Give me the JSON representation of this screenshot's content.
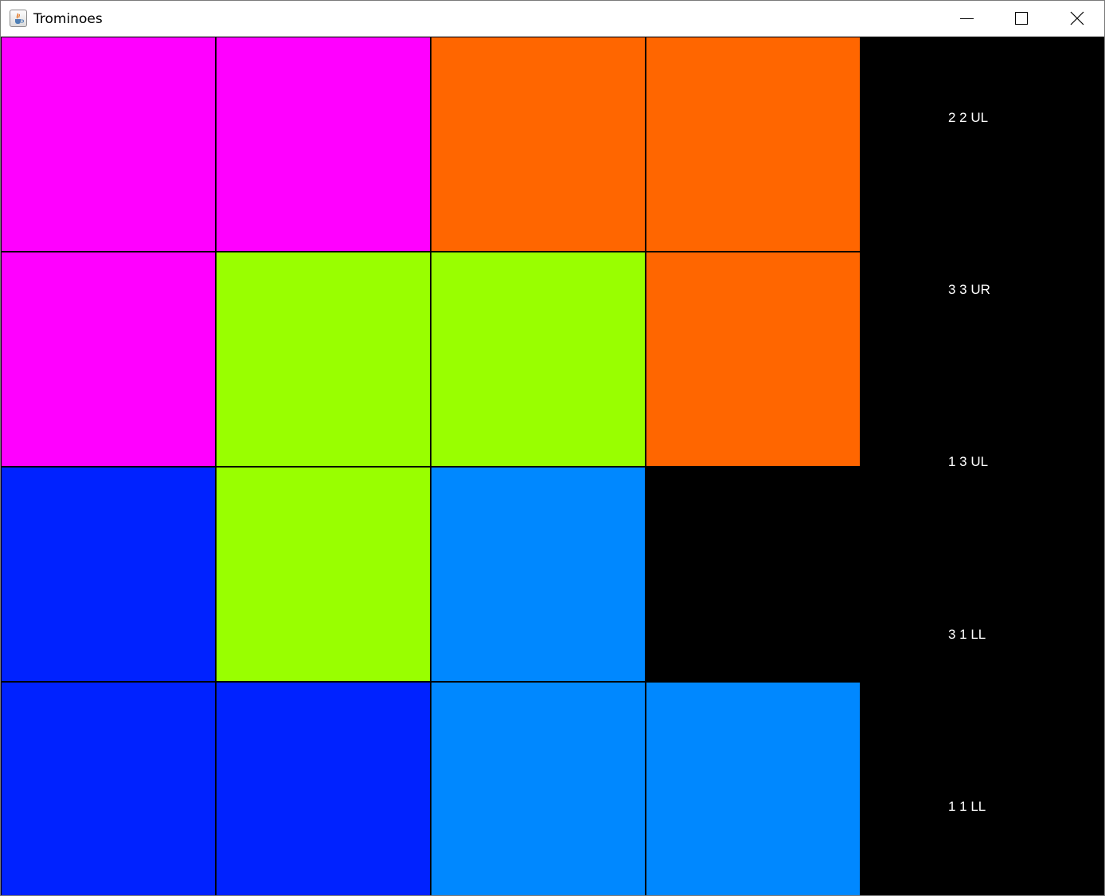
{
  "window": {
    "title": "Trominoes",
    "app_icon": "java-cup-icon",
    "controls": {
      "minimize": "minimize-icon",
      "maximize": "maximize-icon",
      "close": "close-icon"
    }
  },
  "board": {
    "size": 4,
    "colors": {
      "magenta": "#ff00ff",
      "orange": "#ff6600",
      "lime": "#99ff00",
      "blue": "#0022ff",
      "lightblue": "#0088ff",
      "empty": "#000000"
    },
    "rows": [
      [
        "magenta",
        "magenta",
        "orange",
        "orange"
      ],
      [
        "magenta",
        "lime",
        "lime",
        "orange"
      ],
      [
        "blue",
        "lime",
        "lightblue",
        "empty"
      ],
      [
        "blue",
        "blue",
        "lightblue",
        "lightblue"
      ]
    ]
  },
  "moves": [
    "2 2 UL",
    "3 3 UR",
    "1 3 UL",
    "3 1 LL",
    "1 1 LL"
  ]
}
